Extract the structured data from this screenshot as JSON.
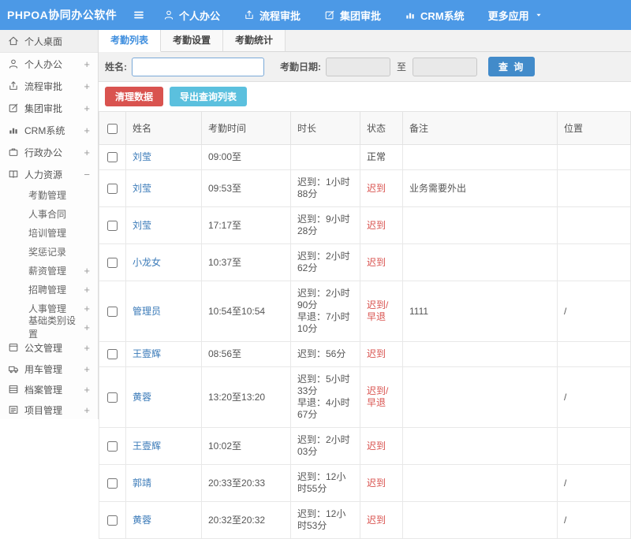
{
  "app": {
    "title": "PHPOA协同办公软件"
  },
  "topnav": {
    "items": [
      {
        "label": "个人办公",
        "icon": "user"
      },
      {
        "label": "流程审批",
        "icon": "share"
      },
      {
        "label": "集团审批",
        "icon": "edit"
      },
      {
        "label": "CRM系统",
        "icon": "chart"
      },
      {
        "label": "更多应用",
        "icon": "caret-down"
      }
    ]
  },
  "sidebar": {
    "items": [
      {
        "label": "个人桌面",
        "icon": "home",
        "active": true
      },
      {
        "label": "个人办公",
        "icon": "user",
        "expander": "+"
      },
      {
        "label": "流程审批",
        "icon": "share",
        "expander": "+"
      },
      {
        "label": "集团审批",
        "icon": "edit",
        "expander": "+"
      },
      {
        "label": "CRM系统",
        "icon": "chart",
        "expander": "+"
      },
      {
        "label": "行政办公",
        "icon": "briefcase",
        "expander": "+"
      },
      {
        "label": "人力资源",
        "icon": "book",
        "expander": "−",
        "children": [
          {
            "label": "考勤管理"
          },
          {
            "label": "人事合同"
          },
          {
            "label": "培训管理"
          },
          {
            "label": "奖惩记录"
          },
          {
            "label": "薪资管理",
            "expander": "+"
          },
          {
            "label": "招聘管理",
            "expander": "+"
          },
          {
            "label": "人事管理",
            "expander": "+"
          },
          {
            "label": "基础类别设置",
            "expander": "+"
          }
        ]
      },
      {
        "label": "公文管理",
        "icon": "doc",
        "expander": "+"
      },
      {
        "label": "用车管理",
        "icon": "truck",
        "expander": "+"
      },
      {
        "label": "档案管理",
        "icon": "archive",
        "expander": "+"
      },
      {
        "label": "项目管理",
        "icon": "list",
        "expander": "+"
      }
    ]
  },
  "tabs": [
    {
      "label": "考勤列表",
      "active": true
    },
    {
      "label": "考勤设置",
      "active": false
    },
    {
      "label": "考勤统计",
      "active": false
    }
  ],
  "filter": {
    "name_label": "姓名:",
    "name_value": "",
    "date_label": "考勤日期:",
    "date_from": "",
    "to_label": "至",
    "date_to": "",
    "search_button": "查 询"
  },
  "actions": {
    "clean": "清理数据",
    "export": "导出查询列表"
  },
  "table": {
    "headers": [
      "姓名",
      "考勤时间",
      "时长",
      "状态",
      "备注",
      "位置"
    ],
    "rows": [
      {
        "name": "刘莹",
        "time": "09:00至",
        "duration": [],
        "status": "正常",
        "status_type": "normal",
        "note": "",
        "location": ""
      },
      {
        "name": "刘莹",
        "time": "09:53至",
        "duration": [
          "迟到：1小时88分"
        ],
        "status": "迟到",
        "status_type": "late",
        "note": "业务需要外出",
        "location": ""
      },
      {
        "name": "刘莹",
        "time": "17:17至",
        "duration": [
          "迟到：9小时28分"
        ],
        "status": "迟到",
        "status_type": "late",
        "note": "",
        "location": ""
      },
      {
        "name": "小龙女",
        "time": "10:37至",
        "duration": [
          "迟到：2小时62分"
        ],
        "status": "迟到",
        "status_type": "late",
        "note": "",
        "location": ""
      },
      {
        "name": "管理员",
        "time": "10:54至10:54",
        "duration": [
          "迟到：2小时90分",
          "早退：7小时10分"
        ],
        "status": "迟到/早退",
        "status_type": "late",
        "note": "1111",
        "location": "/"
      },
      {
        "name": "王壹辉",
        "time": "08:56至",
        "duration": [
          "迟到：56分"
        ],
        "status": "迟到",
        "status_type": "late",
        "note": "",
        "location": ""
      },
      {
        "name": "黄蓉",
        "time": "13:20至13:20",
        "duration": [
          "迟到：5小时33分",
          "早退：4小时67分"
        ],
        "status": "迟到/早退",
        "status_type": "late",
        "note": "",
        "location": "/"
      },
      {
        "name": "王壹辉",
        "time": "10:02至",
        "duration": [
          "迟到：2小时03分"
        ],
        "status": "迟到",
        "status_type": "late",
        "note": "",
        "location": ""
      },
      {
        "name": "郭靖",
        "time": "20:33至20:33",
        "duration": [
          "迟到：12小时55分"
        ],
        "status": "迟到",
        "status_type": "late",
        "note": "",
        "location": "/"
      },
      {
        "name": "黄蓉",
        "time": "20:32至20:32",
        "duration": [
          "迟到：12小时53分"
        ],
        "status": "迟到",
        "status_type": "late",
        "note": "",
        "location": "/"
      }
    ]
  },
  "colors": {
    "topbar": "#4c99e6",
    "link": "#3a7ab8",
    "red": "#d9534f",
    "search_blue": "#428bca",
    "export_blue": "#5bc0de",
    "tab_active": "#3e8ede"
  }
}
